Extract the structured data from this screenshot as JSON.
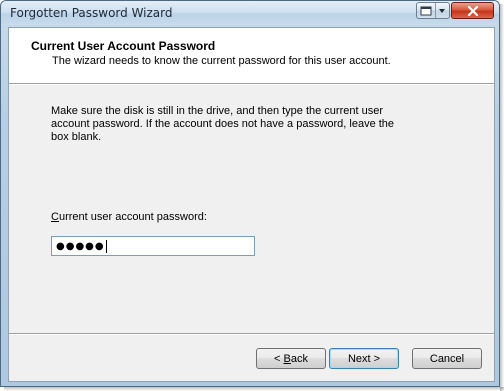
{
  "window": {
    "title": "Forgotten Password Wizard"
  },
  "titlebar_buttons": {
    "help_icon": "help-icon",
    "menu_icon": "chevron-down-icon",
    "close_icon": "close-icon"
  },
  "header": {
    "title": "Current User Account Password",
    "subtitle": "The wizard needs to know the current password for this user account."
  },
  "body": {
    "instructions": "Make sure the disk is still in the drive, and then type the current user account password. If the account does not have a password, leave the box blank."
  },
  "password_field": {
    "label_accel": "C",
    "label_rest": "urrent user account password:",
    "masked_value": "●●●●●"
  },
  "buttons": {
    "back_accel": "B",
    "back_prefix": "< ",
    "back_rest": "ack",
    "next_label": "Next >",
    "cancel_label": "Cancel"
  },
  "colors": {
    "close_button": "#c53519",
    "titlebar": "#cfe0ef",
    "client_bg": "#f0f0f0",
    "default_button_border": "#3c7fb1"
  }
}
